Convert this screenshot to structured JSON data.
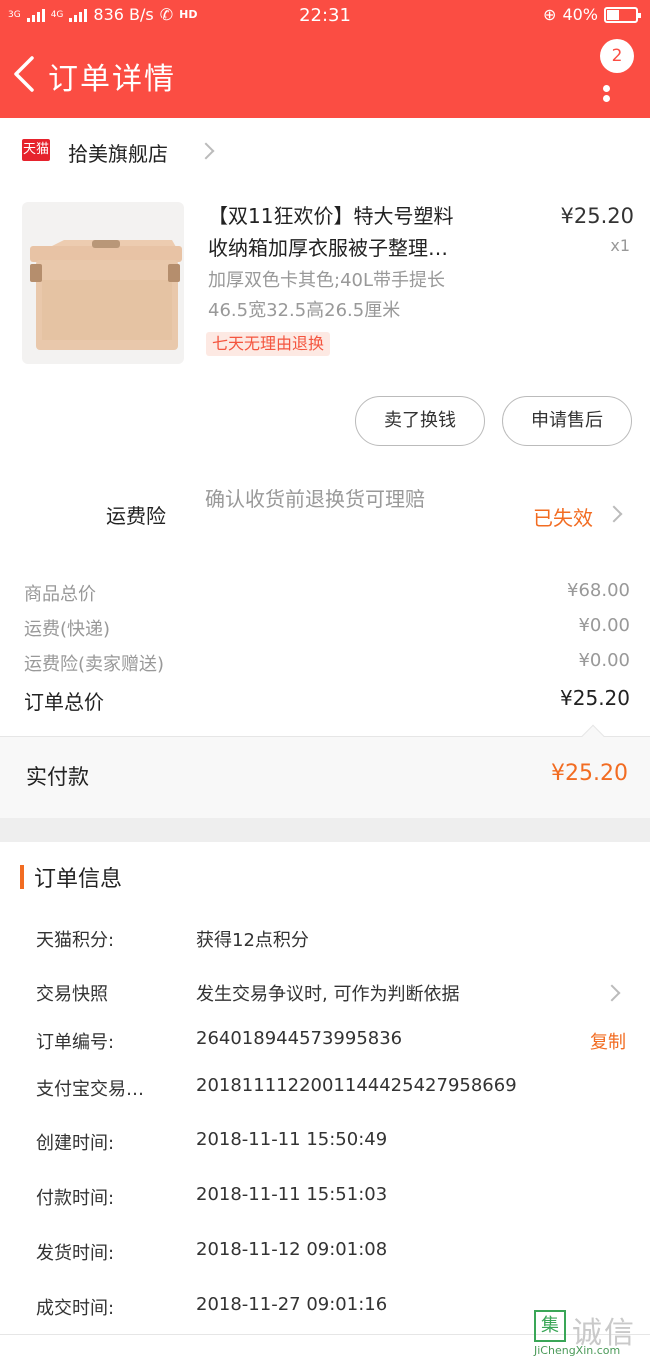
{
  "status_bar": {
    "net1": "3G",
    "net2": "4G",
    "speed": "836 B/s",
    "hd": "HD",
    "time": "22:31",
    "battery": "40%",
    "battery_level": 0.4
  },
  "header": {
    "title": "订单详情",
    "badge": "2"
  },
  "shop": {
    "badge": "天猫",
    "name": "拾美旗舰店"
  },
  "product": {
    "title_line1": "【双11狂欢价】特大号塑料",
    "title_line2": "收纳箱加厚衣服被子整理…",
    "price": "¥25.20",
    "qty": "x1",
    "spec_line1": "加厚双色卡其色;40L带手提长",
    "spec_line2": "46.5宽32.5高26.5厘米",
    "tag": "七天无理由退换"
  },
  "actions": {
    "sell_label": "卖了换钱",
    "after_sale_label": "申请售后"
  },
  "insurance": {
    "label": "运费险",
    "desc": "确认收货前退换货可理赔",
    "status": "已失效"
  },
  "prices": [
    {
      "label": "商品总价",
      "value": "¥68.00"
    },
    {
      "label": "运费(快递)",
      "value": "¥0.00"
    },
    {
      "label": "运费险(卖家赠送)",
      "value": "¥0.00"
    },
    {
      "label": "订单总价",
      "value": "¥25.20"
    }
  ],
  "payment": {
    "label": "实付款",
    "value": "¥25.20"
  },
  "order_info": {
    "title": "订单信息",
    "rows": [
      {
        "label": "天猫积分:",
        "value": "获得12点积分"
      },
      {
        "label": "交易快照",
        "value": "发生交易争议时, 可作为判断依据"
      },
      {
        "label": "订单编号:",
        "value": "264018944573995836",
        "action": "复制"
      },
      {
        "label": "支付宝交易…",
        "value": "2018111122001144425427958669"
      },
      {
        "label": "创建时间:",
        "value": "2018-11-11 15:50:49"
      },
      {
        "label": "付款时间:",
        "value": "2018-11-11 15:51:03"
      },
      {
        "label": "发货时间:",
        "value": "2018-11-12 09:01:08"
      },
      {
        "label": "成交时间:",
        "value": "2018-11-27 09:01:16"
      }
    ]
  },
  "watermark": {
    "char": "集",
    "cn": "诚信",
    "en": "JiChengXin.com"
  },
  "colors": {
    "brand_red": "#fb4d43",
    "accent_orange": "#f26c22",
    "tmall_red": "#e6232d"
  }
}
